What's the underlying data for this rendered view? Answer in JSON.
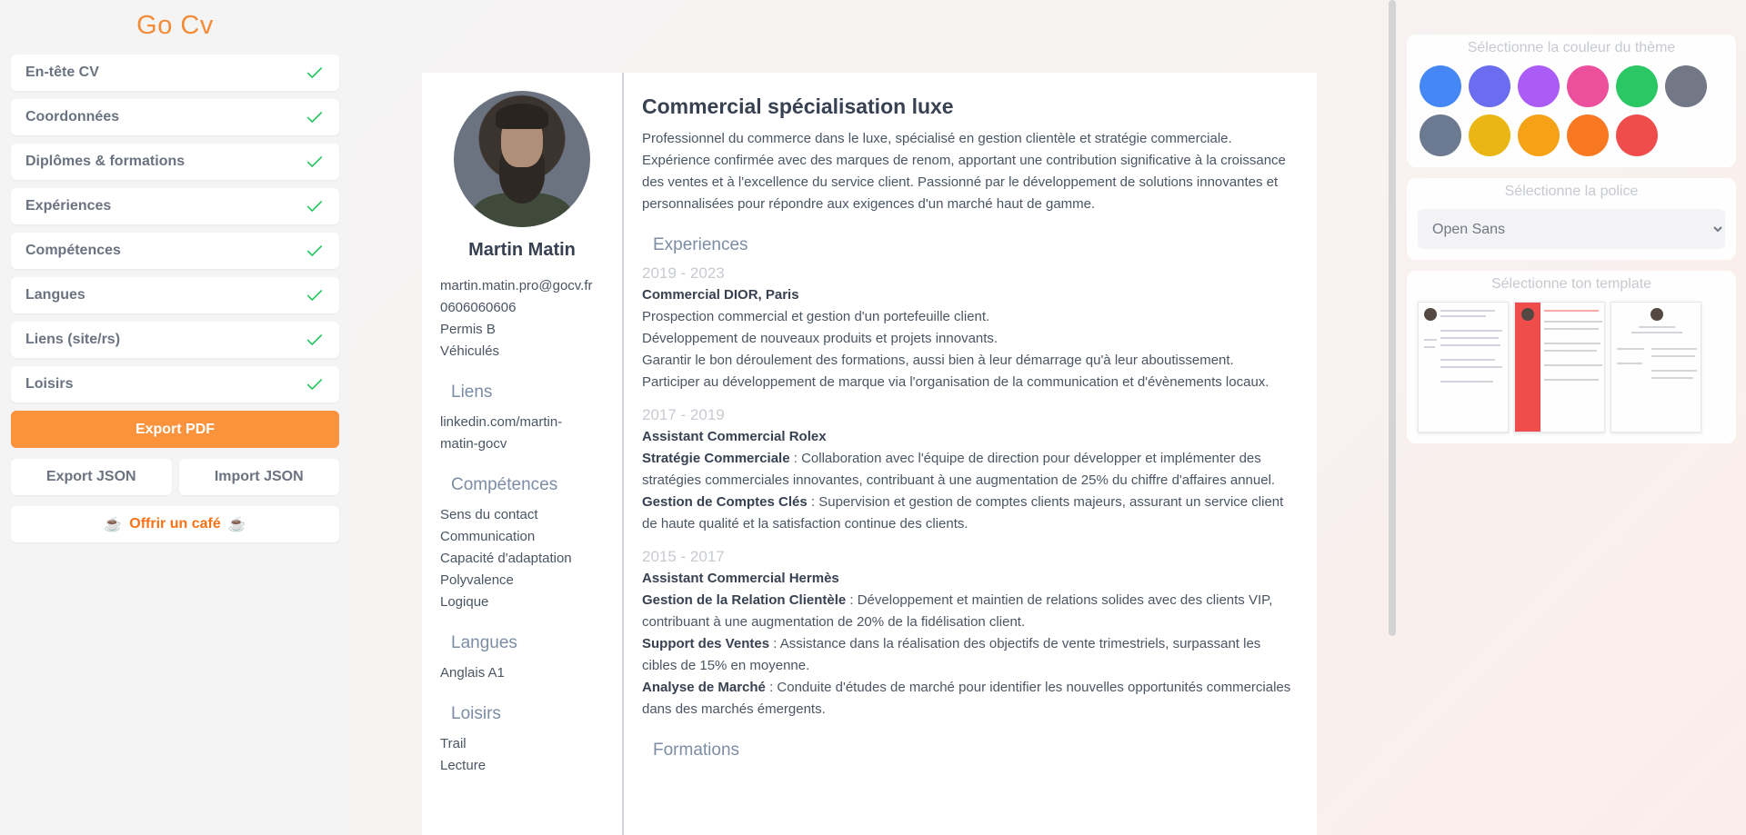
{
  "app": {
    "title": "Go Cv"
  },
  "sidebar": {
    "items": [
      {
        "label": "En-tête CV"
      },
      {
        "label": "Coordonnées"
      },
      {
        "label": "Diplômes & formations"
      },
      {
        "label": "Expériences"
      },
      {
        "label": "Compétences"
      },
      {
        "label": "Langues"
      },
      {
        "label": "Liens (site/rs)"
      },
      {
        "label": "Loisirs"
      }
    ],
    "export_pdf": "Export PDF",
    "export_json": "Export JSON",
    "import_json": "Import JSON",
    "coffee": "Offrir un café",
    "coffee_icon": "☕"
  },
  "cv": {
    "name": "Martin Matin",
    "contact": {
      "email": "martin.matin.pro@gocv.fr",
      "phone": "0606060606",
      "license": "Permis B",
      "vehicle": "Véhiculés"
    },
    "links_heading": "Liens",
    "links": [
      "linkedin.com/martin-",
      "matin-gocv"
    ],
    "skills_heading": "Compétences",
    "skills": [
      "Sens du contact",
      "Communication",
      "Capacité d'adaptation",
      "Polyvalence",
      "Logique"
    ],
    "languages_heading": "Langues",
    "languages": [
      "Anglais A1"
    ],
    "hobbies_heading": "Loisirs",
    "hobbies": [
      "Trail",
      "Lecture"
    ],
    "title": "Commercial spécialisation luxe",
    "summary": "Professionnel du commerce dans le luxe, spécialisé en gestion clientèle et stratégie commerciale. Expérience confirmée avec des marques de renom, apportant une contribution significative à la croissance des ventes et à l'excellence du service client. Passionné par le développement de solutions innovantes et personnalisées pour répondre aux exigences d'un marché haut de gamme.",
    "experiences_heading": "Experiences",
    "experiences": [
      {
        "date": "2019 - 2023",
        "company": "Commercial DIOR, Paris",
        "lines": [
          "Prospection commercial et gestion d'un portefeuille client.",
          "Développement de nouveaux produits et projets innovants.",
          "Garantir le bon déroulement des formations, aussi bien à leur démarrage qu'à leur aboutissement.",
          "Participer au développement de marque via l'organisation de la communication et d'évènements locaux."
        ]
      },
      {
        "date": "2017 - 2019",
        "company": "Assistant Commercial Rolex",
        "items": [
          {
            "bold": "Stratégie Commerciale",
            "text": " : Collaboration avec l'équipe de direction pour développer et implémenter des stratégies commerciales innovantes, contribuant à une augmentation de 25% du chiffre d'affaires annuel."
          },
          {
            "bold": "Gestion de Comptes Clés",
            "text": " : Supervision et gestion de comptes clients majeurs, assurant un service client de haute qualité et la satisfaction continue des clients."
          }
        ]
      },
      {
        "date": "2015 - 2017",
        "company": "Assistant Commercial Hermès",
        "items": [
          {
            "bold": "Gestion de la Relation Clientèle",
            "text": " : Développement et maintien de relations solides avec des clients VIP, contribuant à une augmentation de 20% de la fidélisation client."
          },
          {
            "bold": "Support des Ventes",
            "text": " : Assistance dans la réalisation des objectifs de vente trimestriels, surpassant les cibles de 15% en moyenne."
          },
          {
            "bold": "Analyse de Marché",
            "text": " : Conduite d'études de marché pour identifier les nouvelles opportunités commerciales dans des marchés émergents."
          }
        ]
      }
    ],
    "formations_heading": "Formations"
  },
  "right_panel": {
    "theme_title": "Sélectionne la couleur du thème",
    "theme_colors": [
      "#3b82f6",
      "#6366f1",
      "#a855f7",
      "#ec4899",
      "#22c55e",
      "#6b7280",
      "#64748b",
      "#eab308",
      "#f59e0b",
      "#f97316",
      "#ef4444"
    ],
    "font_title": "Sélectionne la police",
    "font_value": "Open Sans",
    "template_title": "Sélectionne ton template"
  },
  "colors": {
    "accent": "#fb923c",
    "heading": "#7c8da5",
    "check": "#22c55e"
  }
}
